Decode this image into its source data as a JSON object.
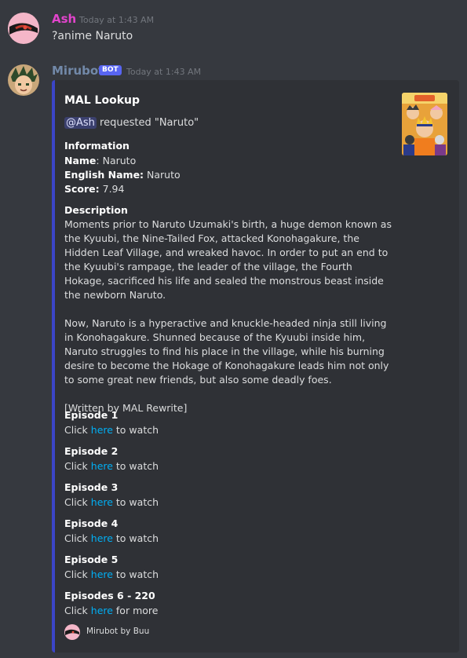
{
  "messages": [
    {
      "username": "Ash",
      "username_color": "#e144cb",
      "timestamp": "Today at 1:43 AM",
      "content": "?anime Naruto"
    },
    {
      "username": "Mirubot",
      "username_color": "#7289a9",
      "bot_tag": "BOT",
      "timestamp": "Today at 1:43 AM"
    }
  ],
  "embed": {
    "title": "MAL Lookup",
    "mention": "@Ash",
    "requested_text": " requested \"Naruto\"",
    "information_heading": "Information",
    "name_label": "Name",
    "name_value": ": Naruto",
    "english_name_label": "English Name:",
    "english_name_value": " Naruto",
    "score_label": "Score:",
    "score_value": " 7.94",
    "description_heading": "Description",
    "description": "Moments prior to Naruto Uzumaki's birth, a huge demon known as the Kyuubi, the Nine-Tailed Fox, attacked Konohagakure, the Hidden Leaf Village, and wreaked havoc. In order to put an end to the Kyuubi's rampage, the leader of the village, the Fourth Hokage, sacrificed his life and sealed the monstrous beast inside the newborn Naruto.\n\nNow, Naruto is a hyperactive and knuckle-headed ninja still living in Konohagakure. Shunned because of the Kyuubi inside him, Naruto struggles to find his place in the village, while his burning desire to become the Hokage of Konohagakure leads him not only to some great new friends, but also some deadly foes.\n\n[Written by MAL Rewrite]",
    "episodes": [
      {
        "title": "Episode 1",
        "prefix": "Click ",
        "link": "here",
        "suffix": " to watch"
      },
      {
        "title": "Episode 2",
        "prefix": "Click ",
        "link": "here",
        "suffix": " to watch"
      },
      {
        "title": "Episode 3",
        "prefix": "Click ",
        "link": "here",
        "suffix": " to watch"
      },
      {
        "title": "Episode 4",
        "prefix": "Click ",
        "link": "here",
        "suffix": " to watch"
      },
      {
        "title": "Episode 5",
        "prefix": "Click ",
        "link": "here",
        "suffix": " to watch"
      },
      {
        "title": "Episodes 6 - 220",
        "prefix": "Click ",
        "link": "here",
        "suffix": " for more"
      }
    ],
    "footer": "Mirubot by Buu",
    "accent_color": "#3b45c8",
    "link_color": "#00aff4"
  }
}
